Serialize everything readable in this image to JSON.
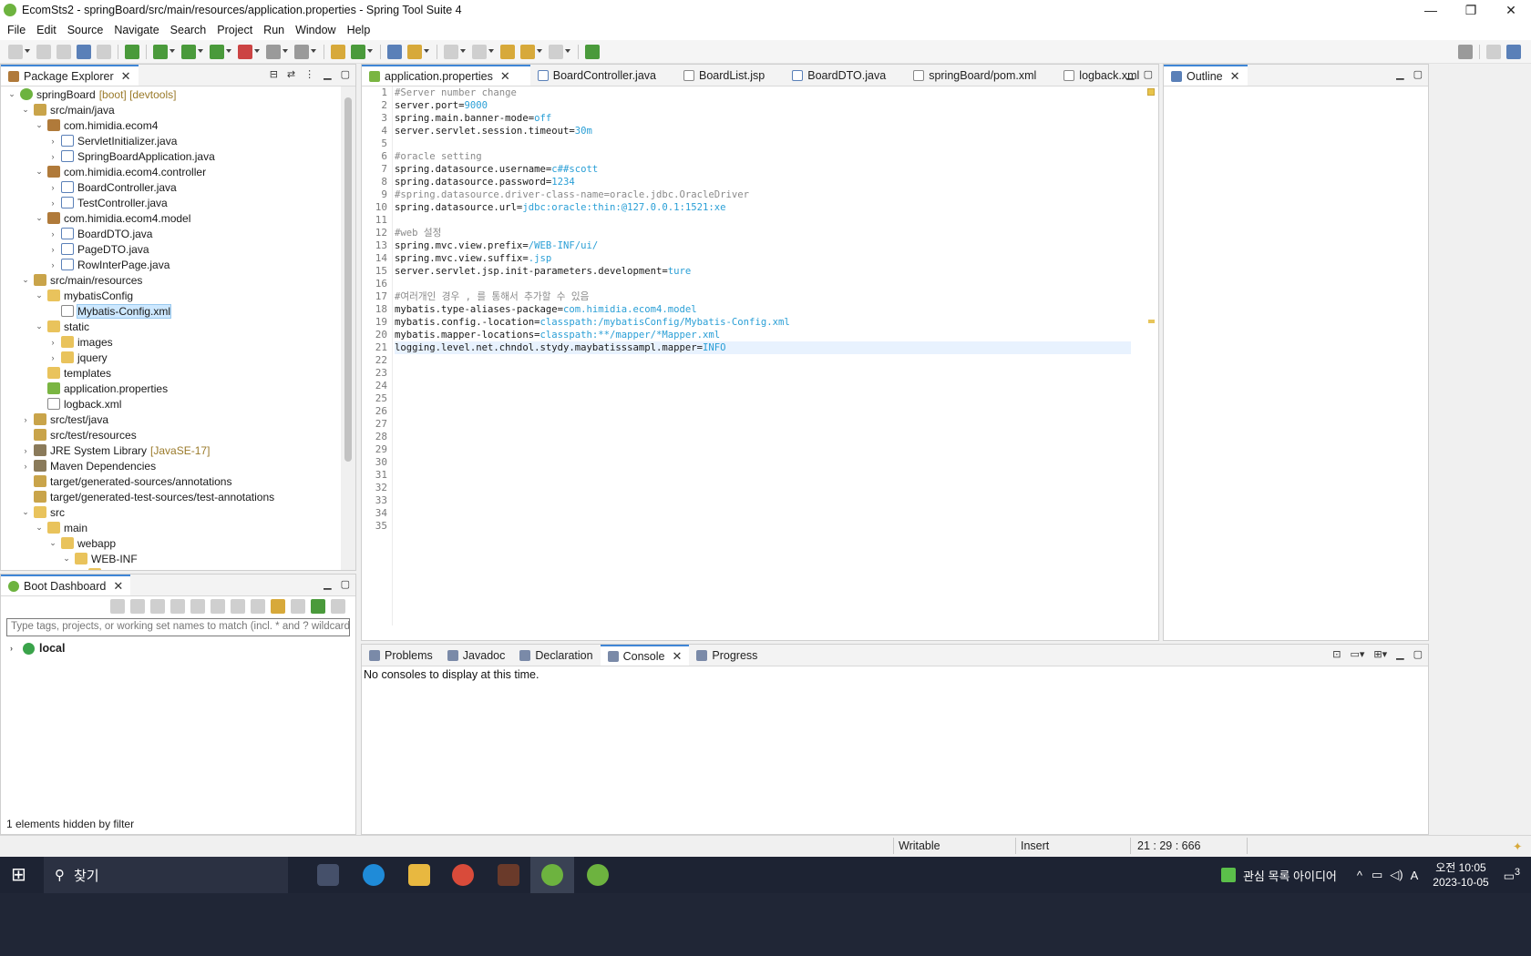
{
  "window": {
    "title": "EcomSts2 - springBoard/src/main/resources/application.properties - Spring Tool Suite 4",
    "controls": [
      "—",
      "❐",
      "✕"
    ]
  },
  "menu": [
    "File",
    "Edit",
    "Source",
    "Navigate",
    "Search",
    "Project",
    "Run",
    "Window",
    "Help"
  ],
  "package_explorer": {
    "tab": "Package Explorer",
    "tree": [
      {
        "label": "springBoard",
        "decor": "[boot] [devtools]",
        "indent": 0,
        "tw": "⌄",
        "icon": "ic-proj"
      },
      {
        "label": "src/main/java",
        "indent": 1,
        "tw": "⌄",
        "icon": "ic-src"
      },
      {
        "label": "com.himidia.ecom4",
        "indent": 2,
        "tw": "⌄",
        "icon": "ic-pkg"
      },
      {
        "label": "ServletInitializer.java",
        "indent": 3,
        "tw": "›",
        "icon": "ic-java"
      },
      {
        "label": "SpringBoardApplication.java",
        "indent": 3,
        "tw": "›",
        "icon": "ic-java"
      },
      {
        "label": "com.himidia.ecom4.controller",
        "indent": 2,
        "tw": "⌄",
        "icon": "ic-pkg"
      },
      {
        "label": "BoardController.java",
        "indent": 3,
        "tw": "›",
        "icon": "ic-java"
      },
      {
        "label": "TestController.java",
        "indent": 3,
        "tw": "›",
        "icon": "ic-java"
      },
      {
        "label": "com.himidia.ecom4.model",
        "indent": 2,
        "tw": "⌄",
        "icon": "ic-pkg"
      },
      {
        "label": "BoardDTO.java",
        "indent": 3,
        "tw": "›",
        "icon": "ic-java"
      },
      {
        "label": "PageDTO.java",
        "indent": 3,
        "tw": "›",
        "icon": "ic-java"
      },
      {
        "label": "RowInterPage.java",
        "indent": 3,
        "tw": "›",
        "icon": "ic-java"
      },
      {
        "label": "src/main/resources",
        "indent": 1,
        "tw": "⌄",
        "icon": "ic-src"
      },
      {
        "label": "mybatisConfig",
        "indent": 2,
        "tw": "⌄",
        "icon": "ic-fold"
      },
      {
        "label": "Mybatis-Config.xml",
        "indent": 3,
        "tw": "",
        "icon": "ic-xml",
        "selected": true
      },
      {
        "label": "static",
        "indent": 2,
        "tw": "⌄",
        "icon": "ic-fold"
      },
      {
        "label": "images",
        "indent": 3,
        "tw": "›",
        "icon": "ic-fold"
      },
      {
        "label": "jquery",
        "indent": 3,
        "tw": "›",
        "icon": "ic-fold"
      },
      {
        "label": "templates",
        "indent": 2,
        "tw": "",
        "icon": "ic-fold"
      },
      {
        "label": "application.properties",
        "indent": 2,
        "tw": "",
        "icon": "ic-prop"
      },
      {
        "label": "logback.xml",
        "indent": 2,
        "tw": "",
        "icon": "ic-xml"
      },
      {
        "label": "src/test/java",
        "indent": 1,
        "tw": "›",
        "icon": "ic-src"
      },
      {
        "label": "src/test/resources",
        "indent": 1,
        "tw": "",
        "icon": "ic-src"
      },
      {
        "label": "JRE System Library",
        "decor": "[JavaSE-17]",
        "indent": 1,
        "tw": "›",
        "icon": "ic-lib"
      },
      {
        "label": "Maven Dependencies",
        "indent": 1,
        "tw": "›",
        "icon": "ic-lib"
      },
      {
        "label": "target/generated-sources/annotations",
        "indent": 1,
        "tw": "",
        "icon": "ic-src"
      },
      {
        "label": "target/generated-test-sources/test-annotations",
        "indent": 1,
        "tw": "",
        "icon": "ic-src"
      },
      {
        "label": "src",
        "indent": 1,
        "tw": "⌄",
        "icon": "ic-fold"
      },
      {
        "label": "main",
        "indent": 2,
        "tw": "⌄",
        "icon": "ic-fold"
      },
      {
        "label": "webapp",
        "indent": 3,
        "tw": "⌄",
        "icon": "ic-fold"
      },
      {
        "label": "WEB-INF",
        "indent": 4,
        "tw": "⌄",
        "icon": "ic-fold"
      },
      {
        "label": "ui",
        "indent": 5,
        "tw": "⌄",
        "icon": "ic-fold"
      }
    ]
  },
  "boot_dashboard": {
    "tab": "Boot Dashboard",
    "filter_placeholder": "Type tags, projects, or working set names to match (incl. * and ? wildcards)",
    "root": "local",
    "hidden_msg": "1 elements hidden by filter"
  },
  "editor": {
    "tabs": [
      {
        "label": "application.properties",
        "active": true,
        "icon": "ic-prop"
      },
      {
        "label": "BoardController.java",
        "icon": "ic-java"
      },
      {
        "label": "BoardList.jsp",
        "icon": "ic-xml"
      },
      {
        "label": "BoardDTO.java",
        "icon": "ic-java"
      },
      {
        "label": "springBoard/pom.xml",
        "icon": "ic-xml"
      },
      {
        "label": "logback.xml",
        "icon": "ic-xml"
      }
    ],
    "current_line": 21,
    "lines": [
      {
        "c": "#Server number change"
      },
      {
        "k": "server.port=",
        "v": "9000"
      },
      {
        "k": "spring.main.banner-mode=",
        "v": "off"
      },
      {
        "k": "server.servlet.session.timeout=",
        "v": "30m"
      },
      {},
      {
        "c": "#oracle setting"
      },
      {
        "k": "spring.datasource.username=",
        "v": "c##scott"
      },
      {
        "k": "spring.datasource.password=",
        "v": "1234"
      },
      {
        "c": "#spring.datasource.driver-class-name=oracle.jdbc.OracleDriver"
      },
      {
        "k": "spring.datasource.url=",
        "v": "jdbc:oracle:thin:@127.0.0.1:1521:xe"
      },
      {},
      {
        "c": "#web 설정"
      },
      {
        "k": "spring.mvc.view.prefix=",
        "v": "/WEB-INF/ui/"
      },
      {
        "k": "spring.mvc.view.suffix=",
        "v": ".jsp"
      },
      {
        "k": "server.servlet.jsp.init-parameters.development=",
        "v": "ture"
      },
      {},
      {
        "c": "#여러개인 경우 , 를 통해서 추가할 수 있음"
      },
      {
        "k": "mybatis.type-aliases-package=",
        "v": "com.himidia.ecom4.model"
      },
      {
        "k": "mybatis.config.-location=",
        "v": "classpath:/mybatisConfig/Mybatis-Config.xml"
      },
      {
        "k": "mybatis.mapper-locations=",
        "v": "classpath:**/mapper/*Mapper.xml"
      },
      {
        "k": "logging.level.net.chndol.stydy.maybatisssampl.mapper=",
        "v": "INFO"
      },
      {},
      {},
      {},
      {},
      {},
      {},
      {},
      {},
      {},
      {},
      {},
      {},
      {},
      {}
    ]
  },
  "outline": {
    "tab": "Outline"
  },
  "console": {
    "tabs": [
      {
        "label": "Problems",
        "icon": "problems-icon"
      },
      {
        "label": "Javadoc",
        "icon": "at-icon"
      },
      {
        "label": "Declaration",
        "icon": "declaration-icon"
      },
      {
        "label": "Console",
        "icon": "console-icon",
        "active": true
      },
      {
        "label": "Progress",
        "icon": "progress-icon"
      }
    ],
    "message": "No consoles to display at this time."
  },
  "status": {
    "writable": "Writable",
    "mode": "Insert",
    "position": "21 : 29 : 666"
  },
  "taskbar": {
    "search_label": "찾기",
    "tray_text": "관심 목록 아이디어",
    "time": "오전 10:05",
    "date": "2023-10-05",
    "notification_count": "3",
    "lang": "A"
  }
}
